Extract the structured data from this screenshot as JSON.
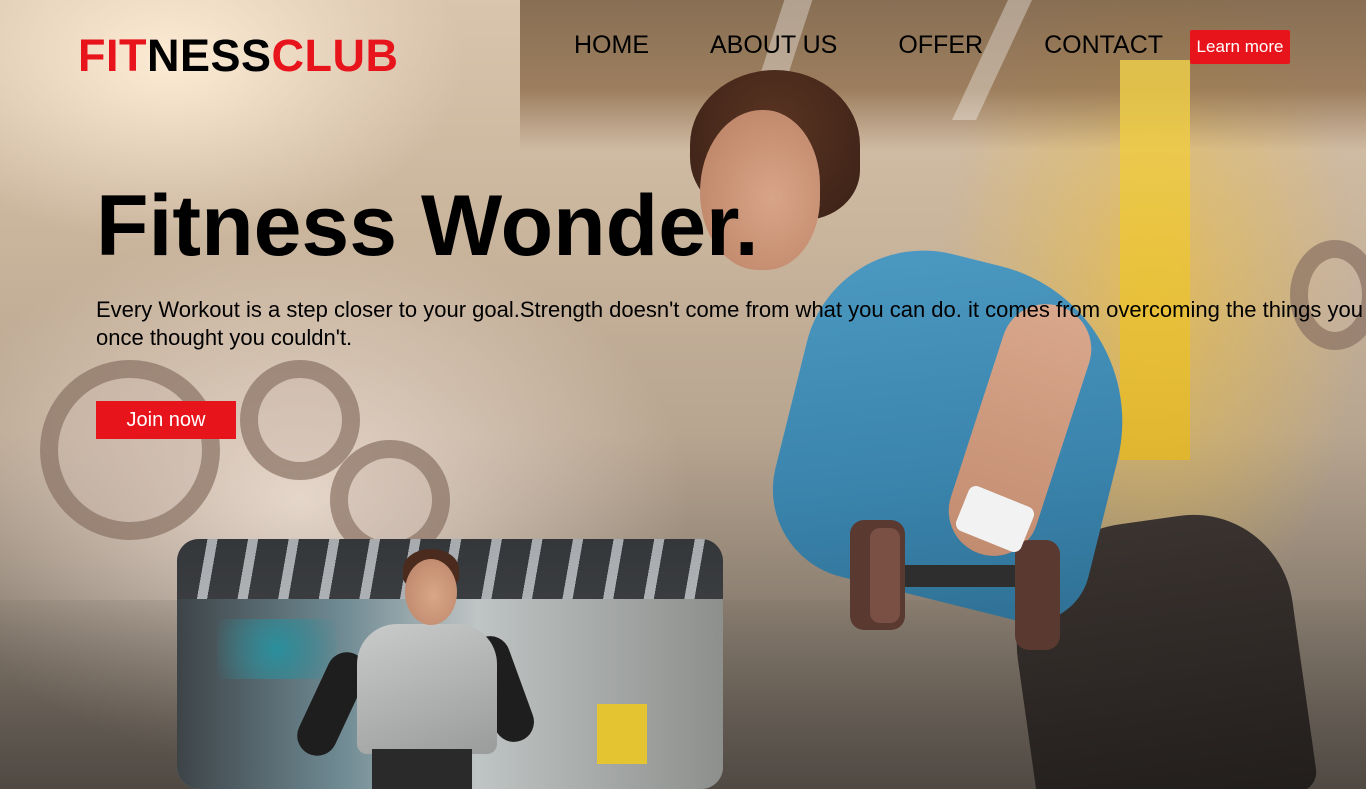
{
  "header": {
    "logo": {
      "part1": "FIT",
      "part2": "NESS",
      "part3": "CLUB"
    },
    "nav": [
      {
        "label": "HOME"
      },
      {
        "label": "ABOUT US"
      },
      {
        "label": "OFFER"
      },
      {
        "label": "CONTACT"
      }
    ],
    "cta_label": "Learn more"
  },
  "hero": {
    "title": "Fitness Wonder.",
    "text": "Every Workout is a step closer to your goal.Strength doesn't come from what you can do. it comes from overcoming the things you once thought you couldn't.",
    "join_label": "Join now"
  },
  "colors": {
    "accent": "#e8141b",
    "text": "#000000"
  }
}
